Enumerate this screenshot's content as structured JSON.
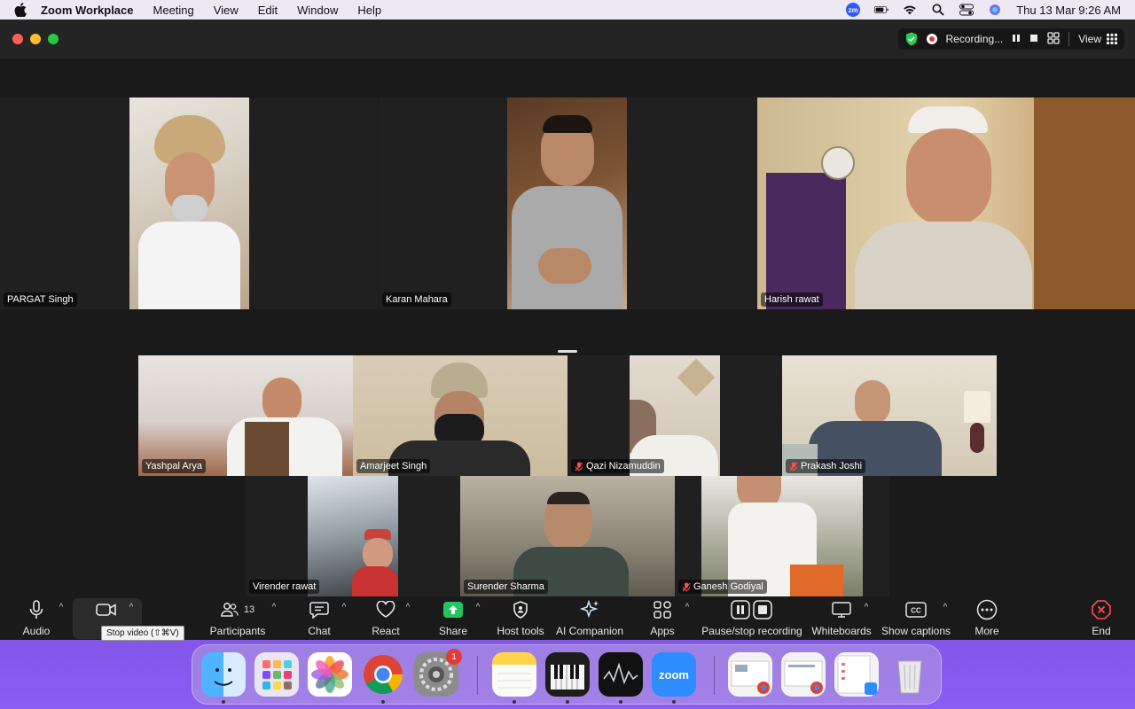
{
  "menubar": {
    "items": [
      "Zoom Workplace",
      "Meeting",
      "View",
      "Edit",
      "Window",
      "Help"
    ],
    "datetime": "Thu 13 Mar  9:26 AM",
    "zm_badge": "zm"
  },
  "titlebar": {
    "recording_label": "Recording...",
    "view_label": "View"
  },
  "participants_top": [
    {
      "name": "PARGAT Singh",
      "muted": false
    },
    {
      "name": "Karan Mahara",
      "muted": false
    },
    {
      "name": "Harish rawat",
      "muted": false,
      "active_speaker": true
    }
  ],
  "participants_mid": [
    {
      "name": "Yashpal Arya",
      "muted": false
    },
    {
      "name": "Amarjeet Singh",
      "muted": false
    },
    {
      "name": "Qazi Nizamuddin",
      "muted": true
    },
    {
      "name": "Prakash Joshi",
      "muted": true
    }
  ],
  "participants_bottom": [
    {
      "name": "Virender rawat",
      "muted": false
    },
    {
      "name": "Surender Sharma",
      "muted": false
    },
    {
      "name": "Ganesh Godiyal",
      "muted": true
    }
  ],
  "toolbar": {
    "audio": "Audio",
    "video": "V",
    "video_tooltip": "Stop video (⇧⌘V)",
    "participants": "Participants",
    "participants_count": "13",
    "chat": "Chat",
    "react": "React",
    "share": "Share",
    "host_tools": "Host tools",
    "ai_companion": "AI Companion",
    "apps": "Apps",
    "pause_stop_recording": "Pause/stop recording",
    "whiteboards": "Whiteboards",
    "show_captions": "Show captions",
    "more": "More",
    "end": "End"
  },
  "dock": {
    "items": [
      "finder-icon",
      "launchpad-icon",
      "photos-icon",
      "chrome-icon",
      "system-settings-icon",
      "notes-icon",
      "piano-icon",
      "stocks-icon",
      "zoom-icon"
    ],
    "settings_badge": "1",
    "zoom_label": "zoom"
  }
}
